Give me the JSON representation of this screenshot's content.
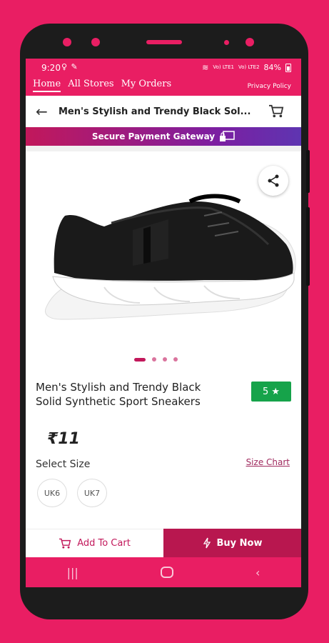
{
  "status_bar": {
    "time": "9:20",
    "icons_left": "♀ ✎",
    "network1": "Vo) LTE1",
    "network2": "Vo) LTE2",
    "battery": "84%"
  },
  "nav_tabs": [
    "Home",
    "All Stores",
    "My Orders"
  ],
  "privacy_link": "Privacy Policy",
  "header": {
    "title": "Men's Stylish and Trendy Black Sol..."
  },
  "secure_banner": "Secure Payment Gateway",
  "product": {
    "name": "Men's Stylish and Trendy Black Solid Synthetic Sport Sneakers",
    "rating": "5",
    "price": "₹11",
    "select_size_label": "Select Size",
    "size_chart_label": "Size Chart",
    "sizes": [
      "UK6",
      "UK7"
    ],
    "image_count": 4,
    "active_image": 1
  },
  "actions": {
    "add_to_cart": "Add To Cart",
    "buy_now": "Buy Now"
  },
  "colors": {
    "brand": "#e91e63",
    "buy_now": "#b8174f",
    "rating": "#16a34a"
  }
}
